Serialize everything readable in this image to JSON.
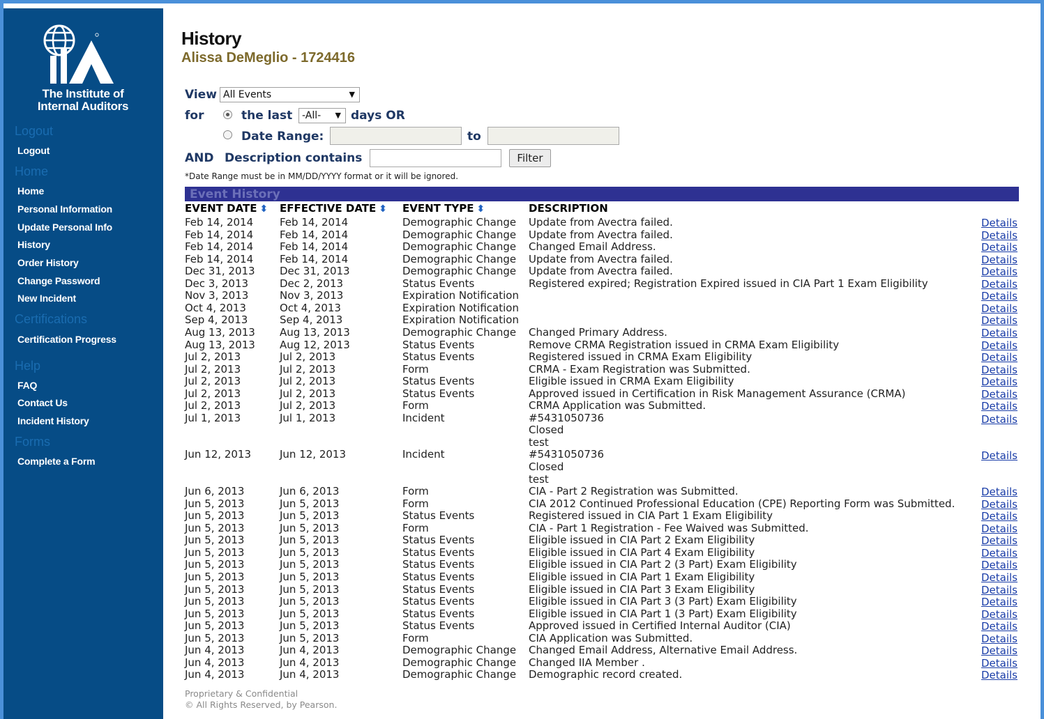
{
  "brand": {
    "org_line1": "The Institute of",
    "org_line2": "Internal Auditors",
    "logo_letters": "IIA",
    "registered_mark": "®",
    "colors": {
      "sidebar": "#064c86",
      "heading_blue": "#1a6cb0",
      "band": "#2e3192",
      "accent_gold": "#7d6a2c",
      "link": "#1a3da8"
    }
  },
  "sidebar": {
    "sections": [
      {
        "heading": "Logout",
        "links": [
          "Logout"
        ]
      },
      {
        "heading": "Home",
        "links": [
          "Home",
          "Personal Information",
          "Update Personal Info",
          "History",
          "Order History",
          "Change Password",
          "New Incident"
        ]
      },
      {
        "heading": "Certifications",
        "links": [
          "Certification Progress"
        ]
      },
      {
        "heading": "Help",
        "links": [
          "FAQ",
          "Contact Us",
          "Incident History"
        ]
      },
      {
        "heading": "Forms",
        "links": [
          "Complete a Form"
        ]
      }
    ]
  },
  "header": {
    "title": "History",
    "member": "Alissa DeMeglio - 1724416"
  },
  "filters": {
    "view_label": "View",
    "view_value": "All Events",
    "for_label": "for",
    "last_label": "the last",
    "days_value": "-All-",
    "days_or_label": "days OR",
    "date_range_label": "Date Range:",
    "to_label": "to",
    "and_label": "AND",
    "description_label": "Description contains",
    "filter_button": "Filter",
    "note": "*Date Range must be in MM/DD/YYYY format or it will be ignored."
  },
  "table": {
    "band_title": "Event History",
    "headers": [
      "EVENT DATE",
      "EFFECTIVE DATE",
      "EVENT TYPE",
      "DESCRIPTION"
    ],
    "details_label": "Details",
    "rows": [
      [
        "Feb 14, 2014",
        "Feb 14, 2014",
        "Demographic Change",
        "Update from Avectra failed."
      ],
      [
        "Feb 14, 2014",
        "Feb 14, 2014",
        "Demographic Change",
        "Update from Avectra failed."
      ],
      [
        "Feb 14, 2014",
        "Feb 14, 2014",
        "Demographic Change",
        "Changed Email Address."
      ],
      [
        "Feb 14, 2014",
        "Feb 14, 2014",
        "Demographic Change",
        "Update from Avectra failed."
      ],
      [
        "Dec 31, 2013",
        "Dec 31, 2013",
        "Demographic Change",
        "Update from Avectra failed."
      ],
      [
        "Dec 3, 2013",
        "Dec 2, 2013",
        "Status Events",
        "Registered expired; Registration Expired issued in CIA Part 1 Exam Eligibility"
      ],
      [
        "Nov 3, 2013",
        "Nov 3, 2013",
        "Expiration Notification",
        ""
      ],
      [
        "Oct 4, 2013",
        "Oct 4, 2013",
        "Expiration Notification",
        ""
      ],
      [
        "Sep 4, 2013",
        "Sep 4, 2013",
        "Expiration Notification",
        ""
      ],
      [
        "Aug 13, 2013",
        "Aug 13, 2013",
        "Demographic Change",
        "Changed Primary Address."
      ],
      [
        "Aug 13, 2013",
        "Aug 12, 2013",
        "Status Events",
        "Remove CRMA Registration issued in CRMA Exam Eligibility"
      ],
      [
        "Jul 2, 2013",
        "Jul 2, 2013",
        "Status Events",
        "Registered issued in CRMA Exam Eligibility"
      ],
      [
        "Jul 2, 2013",
        "Jul 2, 2013",
        "Form",
        "CRMA - Exam Registration was Submitted."
      ],
      [
        "Jul 2, 2013",
        "Jul 2, 2013",
        "Status Events",
        "Eligible issued in CRMA Exam Eligibility"
      ],
      [
        "Jul 2, 2013",
        "Jul 2, 2013",
        "Status Events",
        "Approved issued in Certification in Risk Management Assurance (CRMA)"
      ],
      [
        "Jul 2, 2013",
        "Jul 2, 2013",
        "Form",
        "CRMA Application was Submitted."
      ],
      [
        "Jul 1, 2013",
        "Jul 1, 2013",
        "Incident",
        "#5431050736",
        "Closed",
        "test"
      ],
      [
        "Jun 12, 2013",
        "Jun 12, 2013",
        "Incident",
        "#5431050736",
        "Closed",
        "test"
      ],
      [
        "Jun 6, 2013",
        "Jun 6, 2013",
        "Form",
        "CIA - Part 2 Registration was Submitted."
      ],
      [
        "Jun 5, 2013",
        "Jun 5, 2013",
        "Form",
        "CIA 2012 Continued Professional Education (CPE) Reporting Form was Submitted."
      ],
      [
        "Jun 5, 2013",
        "Jun 5, 2013",
        "Status Events",
        "Registered issued in CIA Part 1 Exam Eligibility"
      ],
      [
        "Jun 5, 2013",
        "Jun 5, 2013",
        "Form",
        "CIA - Part 1 Registration - Fee Waived was Submitted."
      ],
      [
        "Jun 5, 2013",
        "Jun 5, 2013",
        "Status Events",
        "Eligible issued in CIA Part 2 Exam Eligibility"
      ],
      [
        "Jun 5, 2013",
        "Jun 5, 2013",
        "Status Events",
        "Eligible issued in CIA Part 4 Exam Eligibility"
      ],
      [
        "Jun 5, 2013",
        "Jun 5, 2013",
        "Status Events",
        "Eligible issued in CIA Part 2 (3 Part) Exam Eligibility"
      ],
      [
        "Jun 5, 2013",
        "Jun 5, 2013",
        "Status Events",
        "Eligible issued in CIA Part 1 Exam Eligibility"
      ],
      [
        "Jun 5, 2013",
        "Jun 5, 2013",
        "Status Events",
        "Eligible issued in CIA Part 3 Exam Eligibility"
      ],
      [
        "Jun 5, 2013",
        "Jun 5, 2013",
        "Status Events",
        "Eligible issued in CIA Part 3 (3 Part) Exam Eligibility"
      ],
      [
        "Jun 5, 2013",
        "Jun 5, 2013",
        "Status Events",
        "Eligible issued in CIA Part 1 (3 Part) Exam Eligibility"
      ],
      [
        "Jun 5, 2013",
        "Jun 5, 2013",
        "Status Events",
        "Approved issued in Certified Internal Auditor (CIA)"
      ],
      [
        "Jun 5, 2013",
        "Jun 5, 2013",
        "Form",
        "CIA Application was Submitted."
      ],
      [
        "Jun 4, 2013",
        "Jun 4, 2013",
        "Demographic Change",
        "Changed Email Address, Alternative Email Address."
      ],
      [
        "Jun 4, 2013",
        "Jun 4, 2013",
        "Demographic Change",
        "Changed IIA Member ."
      ],
      [
        "Jun 4, 2013",
        "Jun 4, 2013",
        "Demographic Change",
        "Demographic record created."
      ]
    ]
  },
  "footer": {
    "line1": "Proprietary & Confidential",
    "line2": "© All Rights Reserved, by Pearson."
  }
}
